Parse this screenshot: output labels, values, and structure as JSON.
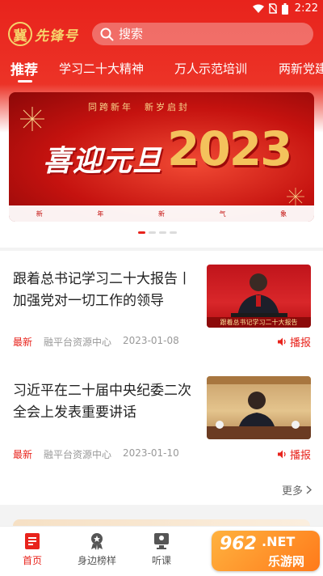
{
  "status_bar": {
    "time": "2:22"
  },
  "header": {
    "logo_badge": "冀",
    "logo_text": "先锋号",
    "search_placeholder": "搜索"
  },
  "tabs": [
    {
      "label": "推荐",
      "active": true
    },
    {
      "label": "学习二十大精神"
    },
    {
      "label": "万人示范培训"
    },
    {
      "label": "两新党建"
    }
  ],
  "banner": {
    "subtitle": "同跨新年　新岁启封",
    "main_text": "喜迎元旦",
    "year": "2023",
    "ribbon": [
      "新",
      "年",
      "新",
      "气",
      "象"
    ],
    "page_count": 4,
    "active_page": 0
  },
  "news": [
    {
      "title": "跟着总书记学习二十大报告丨加强党对一切工作的领导",
      "tag": "最新",
      "source": "融平台资源中心",
      "date": "2023-01-08",
      "play_label": "播报",
      "thumb_caption": "跟着总书记学习二十大报告"
    },
    {
      "title": "习近平在二十届中央纪委二次全会上发表重要讲话",
      "tag": "最新",
      "source": "融平台资源中心",
      "date": "2023-01-10",
      "play_label": "播报",
      "thumb_caption": ""
    }
  ],
  "more_label": "更多",
  "bottom_nav": [
    {
      "label": "首页",
      "icon": "home-icon",
      "active": true
    },
    {
      "label": "身边榜样",
      "icon": "medal-icon"
    },
    {
      "label": "听课",
      "icon": "lecture-icon"
    }
  ],
  "watermark": {
    "num": "962",
    "net": ".NET",
    "cn": "乐游网"
  },
  "colors": {
    "brand_red": "#e8231c",
    "gold": "#f6d36b"
  }
}
